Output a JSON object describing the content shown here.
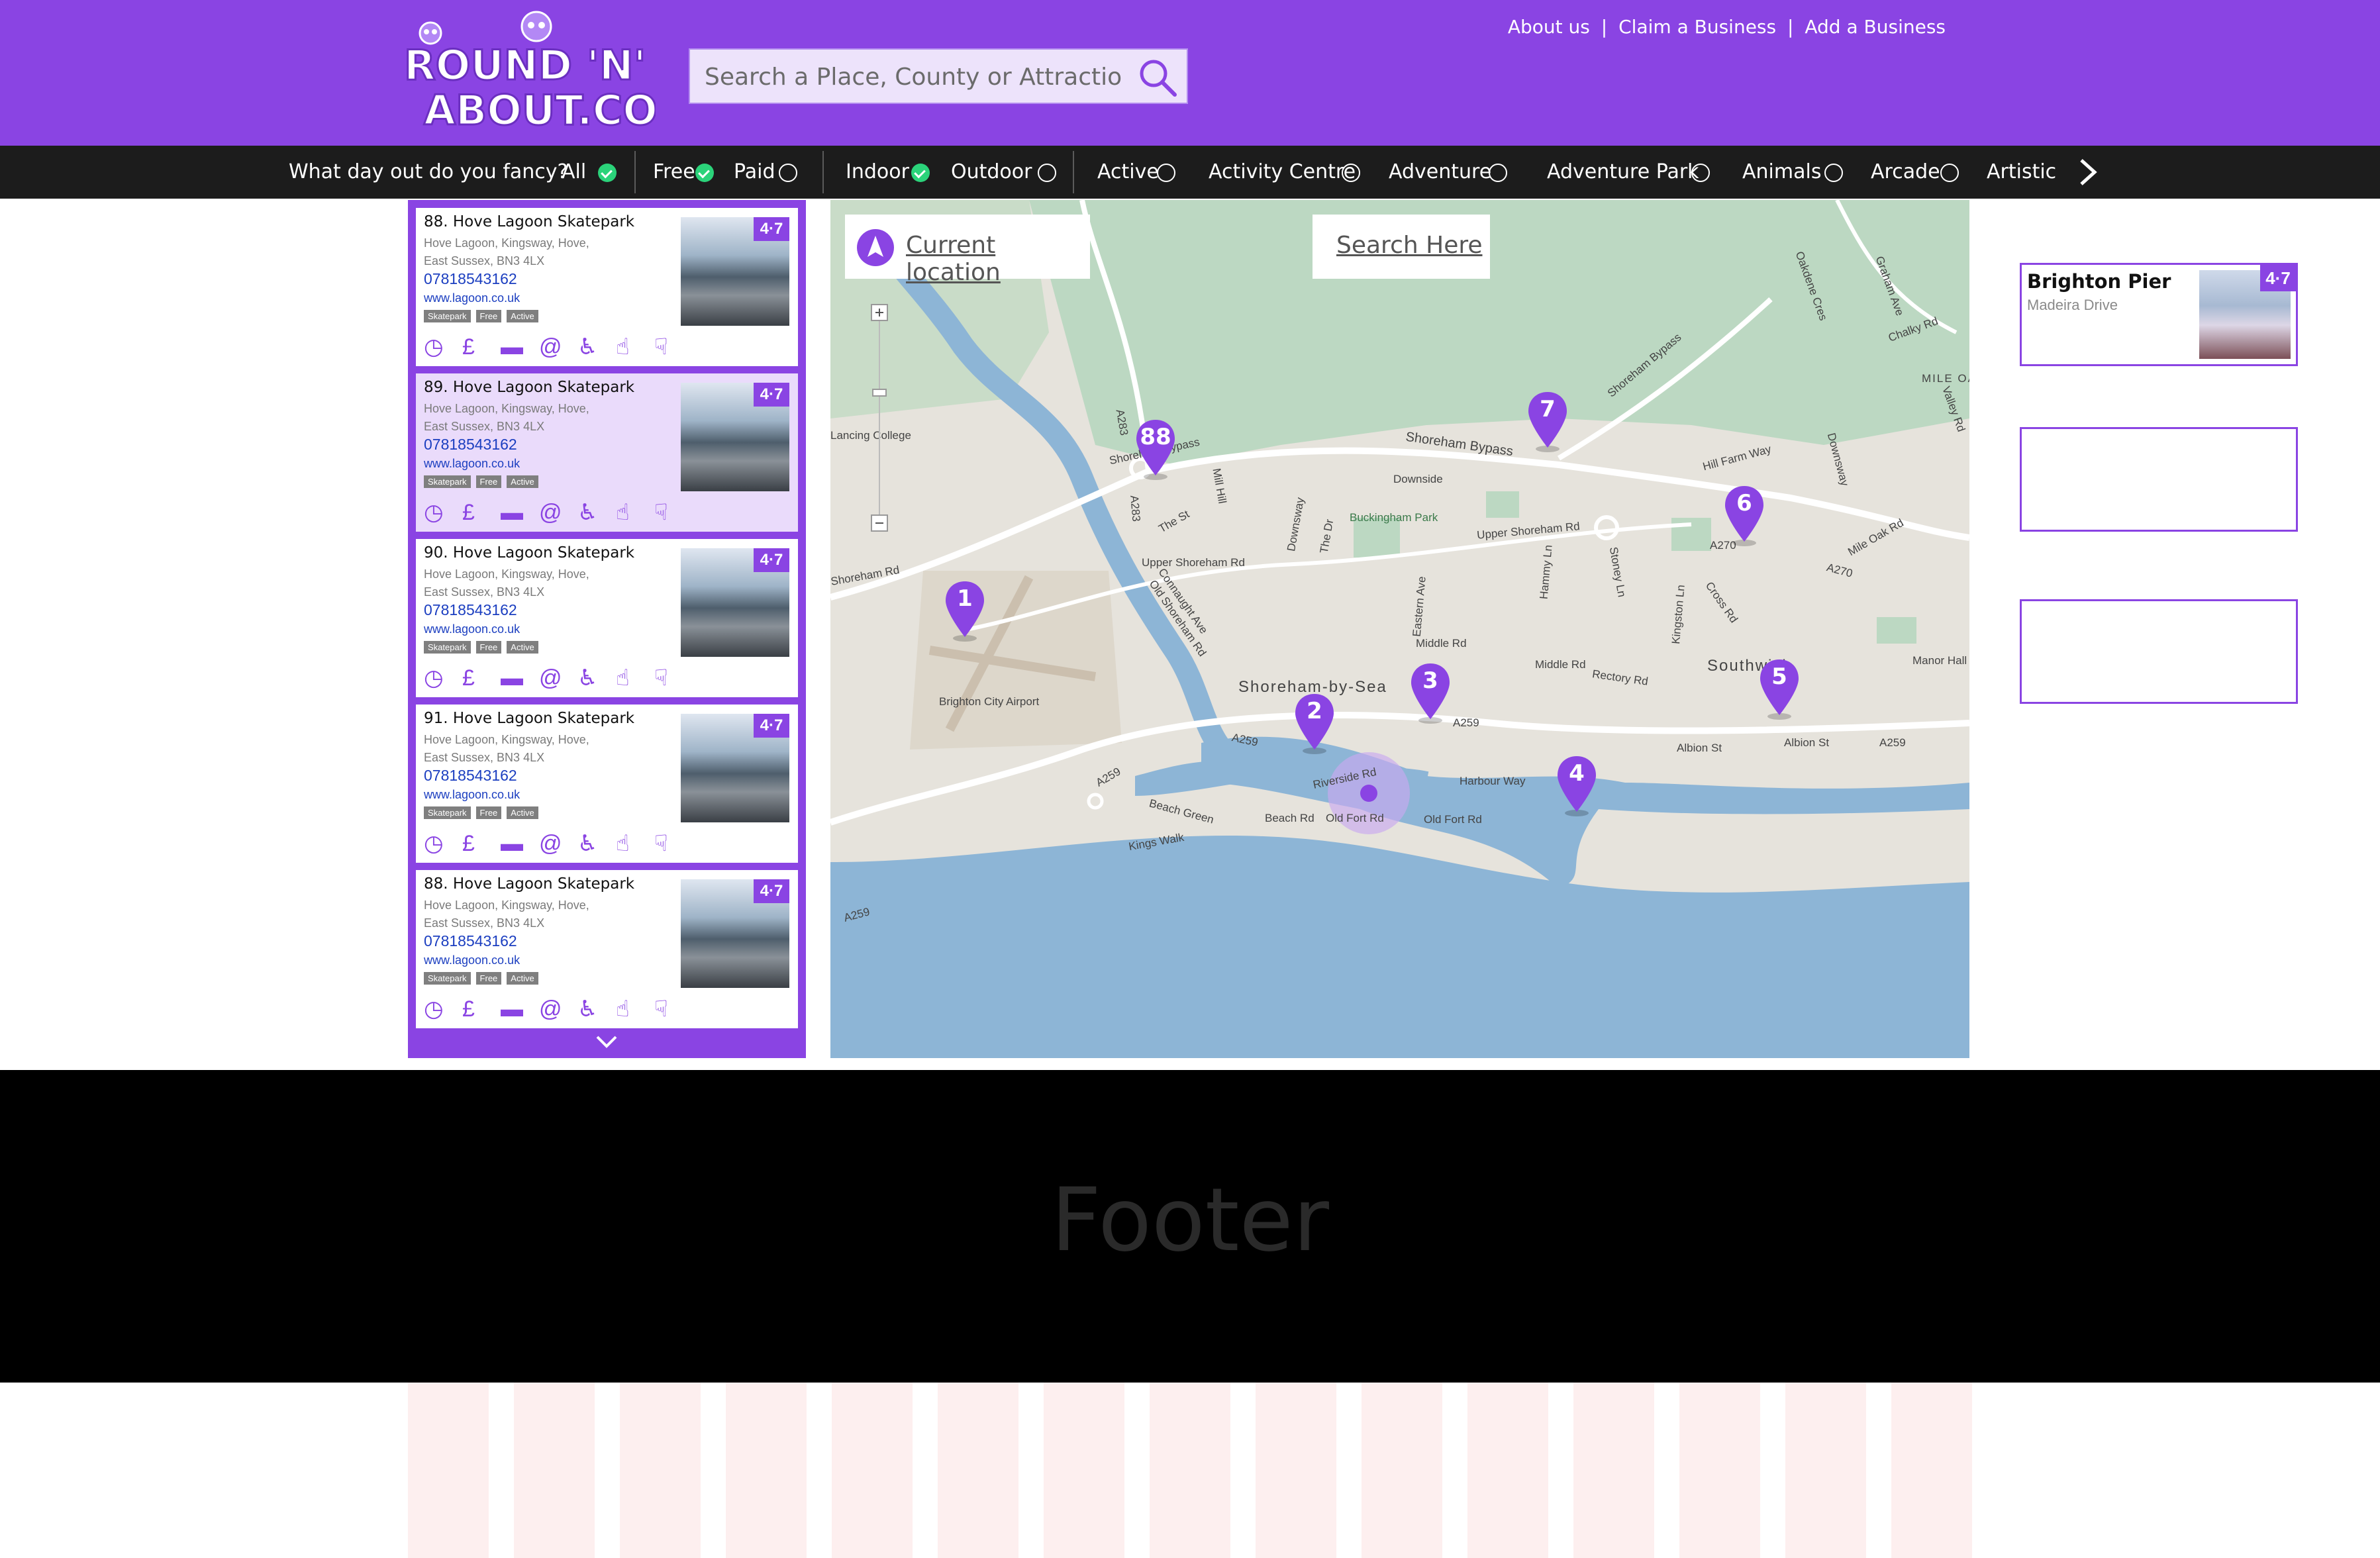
{
  "header": {
    "logo_text_top": "ROUND 'N'",
    "logo_text_bottom": "ABOUT.COM",
    "search": {
      "placeholder": "Search a Place, County or Attraction"
    },
    "links": [
      "About us",
      "Claim a Business",
      "Add a Business"
    ],
    "link_separator": "|"
  },
  "filters": {
    "question": "What day out do you fancy?",
    "items": [
      {
        "label": "All",
        "checked": true
      },
      {
        "label": "Free",
        "checked": true
      },
      {
        "label": "Paid",
        "checked": false
      },
      {
        "label": "Indoor",
        "checked": true
      },
      {
        "label": "Outdoor",
        "checked": false
      },
      {
        "label": "Active",
        "checked": false
      },
      {
        "label": "Activity Centre",
        "checked": false
      },
      {
        "label": "Adventure",
        "checked": false
      },
      {
        "label": "Adventure Park",
        "checked": false
      },
      {
        "label": "Animals",
        "checked": false
      },
      {
        "label": "Arcade",
        "checked": false
      },
      {
        "label": "Artistic",
        "checked": false
      }
    ]
  },
  "listings": [
    {
      "title": "88. Hove Lagoon Skatepark",
      "addr1": "Hove Lagoon, Kingsway, Hove,",
      "addr2": "East Sussex, BN3 4LX",
      "phone": "07818543162",
      "web": "www.lagoon.co.uk",
      "tags": [
        "Skatepark",
        "Free",
        "Active"
      ],
      "rating": "4·7",
      "selected": false
    },
    {
      "title": "89. Hove Lagoon Skatepark",
      "addr1": "Hove Lagoon, Kingsway, Hove,",
      "addr2": "East Sussex, BN3 4LX",
      "phone": "07818543162",
      "web": "www.lagoon.co.uk",
      "tags": [
        "Skatepark",
        "Free",
        "Active"
      ],
      "rating": "4·7",
      "selected": true
    },
    {
      "title": "90. Hove Lagoon Skatepark",
      "addr1": "Hove Lagoon, Kingsway, Hove,",
      "addr2": "East Sussex, BN3 4LX",
      "phone": "07818543162",
      "web": "www.lagoon.co.uk",
      "tags": [
        "Skatepark",
        "Free",
        "Active"
      ],
      "rating": "4·7",
      "selected": false
    },
    {
      "title": "91. Hove Lagoon Skatepark",
      "addr1": "Hove Lagoon, Kingsway, Hove,",
      "addr2": "East Sussex, BN3 4LX",
      "phone": "07818543162",
      "web": "www.lagoon.co.uk",
      "tags": [
        "Skatepark",
        "Free",
        "Active"
      ],
      "rating": "4·7",
      "selected": false
    },
    {
      "title": "88. Hove Lagoon Skatepark",
      "addr1": "Hove Lagoon, Kingsway, Hove,",
      "addr2": "East Sussex, BN3 4LX",
      "phone": "07818543162",
      "web": "www.lagoon.co.uk",
      "tags": [
        "Skatepark",
        "Free",
        "Active"
      ],
      "rating": "4·7",
      "selected": false
    }
  ],
  "listing_icons": [
    "clock-icon",
    "pound-icon",
    "comment-icon",
    "email-icon",
    "accessible-icon",
    "thumbs-up-icon",
    "thumbs-down-icon"
  ],
  "map": {
    "current_location": "Current location",
    "search_here": "Search Here",
    "labels": [
      "Shoreham Bypass",
      "Shoreham Bypass",
      "Shoreham Bypass",
      "Upper Shoreham Rd",
      "Upper Shoreham Rd",
      "Shoreham Rd",
      "Shoreham-by-Sea",
      "Brighton City Airport",
      "Buckingham Park",
      "Downside",
      "Old Shoreham Rd",
      "Connaught Ave",
      "Mill Hill",
      "The St",
      "Downsway",
      "The Dr",
      "Eastern Ave",
      "Middle Rd",
      "Middle Rd",
      "Rectory Rd",
      "Hammy Ln",
      "Stoney Ln",
      "Kingston Ln",
      "Cross Rd",
      "A270",
      "A270",
      "A283",
      "A283",
      "A259",
      "A259",
      "A259",
      "A259",
      "A259",
      "Albion St",
      "Albion St",
      "Harbour Way",
      "Riverside Rd",
      "Beach Rd",
      "Old Fort Rd",
      "Old Fort Rd",
      "Beach Green",
      "Kings Walk",
      "Hill Farm Way",
      "Mile Oak Rd",
      "Oakdene Cres",
      "Graham Ave",
      "Chalky Rd",
      "Valley Rd",
      "Downsway",
      "Manor Hall",
      "Southwick",
      "MILE OA",
      "Lancing College"
    ],
    "markers": [
      "88",
      "7",
      "6",
      "1",
      "3",
      "2",
      "5",
      "4"
    ]
  },
  "popups": [
    {
      "title": "Brighton Pier",
      "subtitle": "Madeira Drive",
      "rating": "4·7"
    }
  ],
  "footer": {
    "label": "Footer"
  },
  "colors": {
    "brand": "#8a44e3",
    "filterbar": "#1c1c1c",
    "check": "#2bd37a",
    "sea": "#8db5d6",
    "park": "#bcd8c2",
    "land": "#e8e4dc",
    "footer": "#000000"
  }
}
